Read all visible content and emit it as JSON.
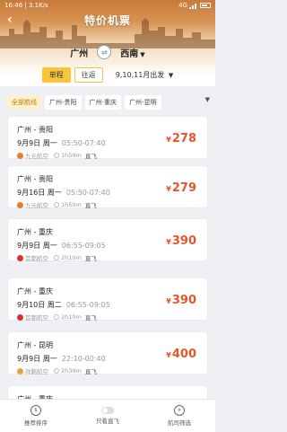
{
  "status_bar": {
    "time": "16:46",
    "speed": "3.1K/s",
    "network": "4G",
    "signal_icon": "signal-icon",
    "battery_icon": "battery-icon"
  },
  "header": {
    "title": "特价机票",
    "back_icon": "back-arrow-icon"
  },
  "route": {
    "from": "广州",
    "to": "西南",
    "swap_icon": "swap-icon",
    "to_dropdown_icon": "chevron-down-icon"
  },
  "trip": {
    "one_way": "单程",
    "round_trip": "往返",
    "dates": "9,10,11月出发",
    "dates_dropdown_icon": "chevron-down-icon"
  },
  "filters": {
    "chips": [
      "全部航线",
      "广州-贵阳",
      "广州-重庆",
      "广州-昆明"
    ],
    "more_icon": "dropdown-icon"
  },
  "flights": [
    {
      "cities": "广州 - 贵阳",
      "date": "9月9日 周一",
      "times": "05:50-07:40",
      "airline": "九元航空",
      "duration": "1h50m",
      "direct": "直飞",
      "price_symbol": "¥",
      "price": "278",
      "logo_color": "#ee7a2a"
    },
    {
      "cities": "广州 - 贵阳",
      "date": "9月16日 周一",
      "times": "05:50-07:40",
      "airline": "九元航空",
      "duration": "1h50m",
      "direct": "直飞",
      "price_symbol": "¥",
      "price": "279",
      "logo_color": "#ee7a2a"
    },
    {
      "cities": "广州 - 重庆",
      "date": "9月9日 周一",
      "times": "06:55-09:05",
      "airline": "首都航空",
      "duration": "2h10m",
      "direct": "直飞",
      "price_symbol": "¥",
      "price": "390",
      "logo_color": "#d9302c"
    },
    {
      "cities": "广州 - 重庆",
      "date": "9月10日 周二",
      "times": "06:55-09:05",
      "airline": "首都航空",
      "duration": "2h10m",
      "direct": "直飞",
      "price_symbol": "¥",
      "price": "390",
      "logo_color": "#d9302c"
    },
    {
      "cities": "广州 - 昆明",
      "date": "9月9日 周一",
      "times": "22:10-00:40",
      "airline": "祥鹏航空",
      "duration": "2h30m",
      "direct": "直飞",
      "price_symbol": "¥",
      "price": "400",
      "logo_color": "#e8a23a"
    },
    {
      "cities": "广州 - 重庆",
      "date": "",
      "times": "",
      "airline": "",
      "duration": "",
      "direct": "",
      "price_symbol": "",
      "price": "",
      "logo_color": "#d9302c"
    }
  ],
  "tabbar": {
    "sort": "推荐排序",
    "direct_only": "只看直飞",
    "airline_filter": "航司筛选"
  },
  "colors": {
    "accent": "#f8c53b",
    "price": "#e4572e",
    "header_top": "#c87a3a"
  }
}
